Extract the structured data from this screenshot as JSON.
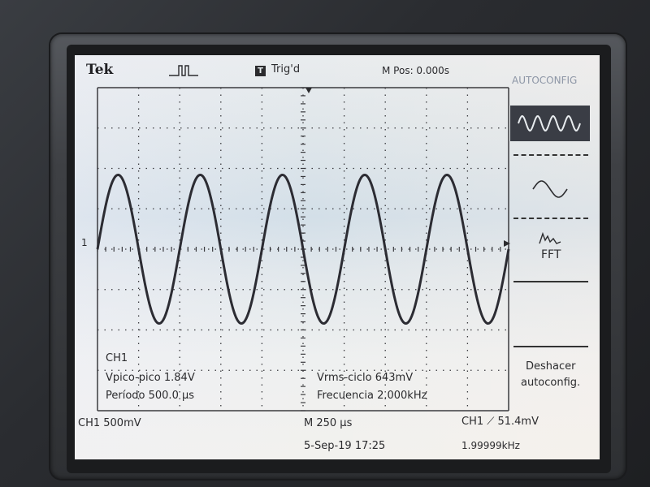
{
  "header": {
    "brand": "Tek",
    "trigger_state": "Trig'd",
    "trigger_box": "T",
    "m_pos": "M Pos: 0.000s",
    "menu_title": "AUTOCONFIG"
  },
  "channel_marker": "1",
  "measurements": {
    "channel": "CH1",
    "vpp": "Vpico-pico 1.84V",
    "period": "Período 500.0 µs",
    "vrms": "Vrms-ciclo 643mV",
    "freq": "Frecuencia 2.000kHz"
  },
  "side_menu": {
    "fft_label": "FFT",
    "undo_line1": "Deshacer",
    "undo_line2": "autoconfig."
  },
  "status": {
    "ch1_scale": "CH1  500mV",
    "timebase": "M 250 µs",
    "trigger": "CH1 ⟋ 51.4mV",
    "date": "5-Sep-19 17:25",
    "trig_freq": "1.99999kHz"
  },
  "waveform": {
    "cycles": 5,
    "amplitude_v": 0.92,
    "volts_per_div": 0.5,
    "time_per_div_us": 250,
    "trace_color": "#2c2c33"
  }
}
